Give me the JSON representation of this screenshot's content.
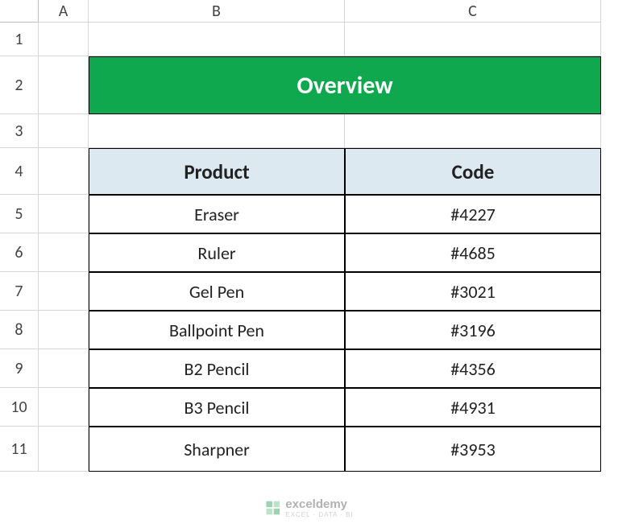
{
  "columns": [
    "A",
    "B",
    "C"
  ],
  "rows": [
    "1",
    "2",
    "3",
    "4",
    "5",
    "6",
    "7",
    "8",
    "9",
    "10",
    "11"
  ],
  "overview_title": "Overview",
  "table": {
    "headers": {
      "product": "Product",
      "code": "Code"
    },
    "data": [
      {
        "product": "Eraser",
        "code": "#4227"
      },
      {
        "product": "Ruler",
        "code": "#4685"
      },
      {
        "product": "Gel Pen",
        "code": "#3021"
      },
      {
        "product": "Ballpoint Pen",
        "code": "#3196"
      },
      {
        "product": "B2 Pencil",
        "code": "#4356"
      },
      {
        "product": "B3 Pencil",
        "code": "#4931"
      },
      {
        "product": "Sharpner",
        "code": "#3953"
      }
    ]
  },
  "watermark": {
    "text": "exceldemy",
    "tagline": "EXCEL · DATA · BI"
  }
}
